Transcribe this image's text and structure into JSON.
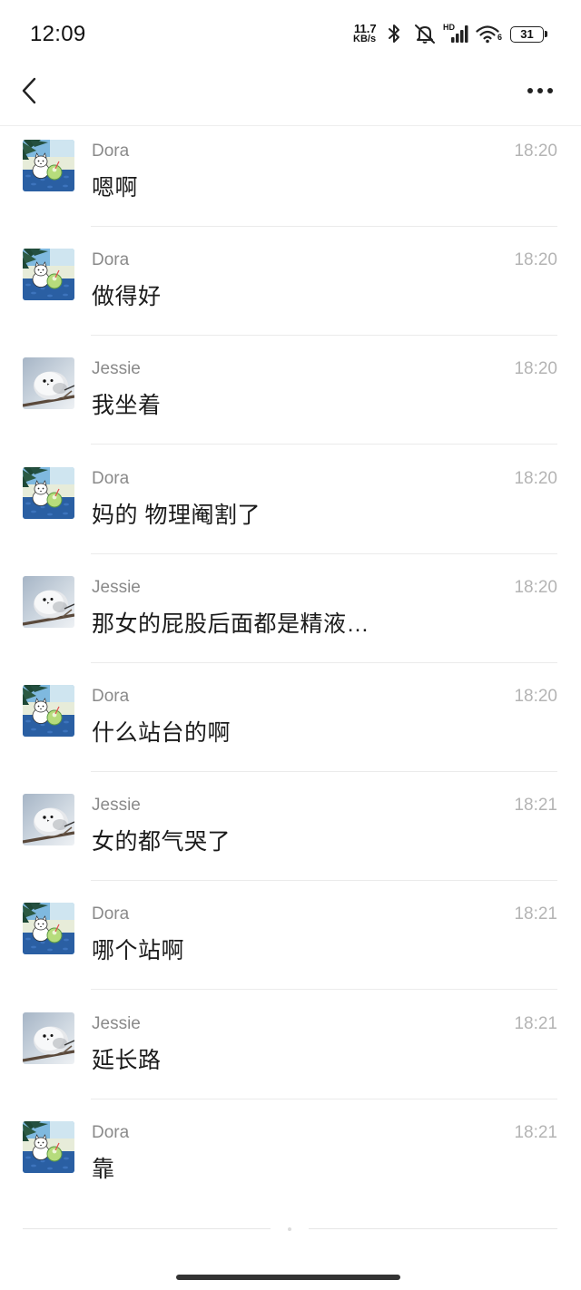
{
  "status_bar": {
    "time": "12:09",
    "net_speed": "11.7",
    "net_speed_unit": "KB/s",
    "signal_label": "HD",
    "wifi_label": "6",
    "battery_level": "31",
    "icons": [
      "bluetooth-icon",
      "notifications-muted-icon",
      "cellular-signal-icon",
      "wifi-icon",
      "battery-icon"
    ]
  },
  "nav": {
    "back_icon": "chevron-left-icon",
    "more_icon": "more-dots-icon"
  },
  "messages": [
    {
      "sender": "Dora",
      "time": "18:20",
      "text": "嗯啊",
      "avatar": "dora-avatar"
    },
    {
      "sender": "Dora",
      "time": "18:20",
      "text": "做得好",
      "avatar": "dora-avatar"
    },
    {
      "sender": "Jessie",
      "time": "18:20",
      "text": "我坐着",
      "avatar": "jessie-avatar"
    },
    {
      "sender": "Dora",
      "time": "18:20",
      "text": "妈的 物理阉割了",
      "avatar": "dora-avatar"
    },
    {
      "sender": "Jessie",
      "time": "18:20",
      "text": "那女的屁股后面都是精液…",
      "avatar": "jessie-avatar"
    },
    {
      "sender": "Dora",
      "time": "18:20",
      "text": "什么站台的啊",
      "avatar": "dora-avatar"
    },
    {
      "sender": "Jessie",
      "time": "18:21",
      "text": "女的都气哭了",
      "avatar": "jessie-avatar"
    },
    {
      "sender": "Dora",
      "time": "18:21",
      "text": "哪个站啊",
      "avatar": "dora-avatar"
    },
    {
      "sender": "Jessie",
      "time": "18:21",
      "text": "延长路",
      "avatar": "jessie-avatar"
    },
    {
      "sender": "Dora",
      "time": "18:21",
      "text": "靠",
      "avatar": "dora-avatar"
    }
  ],
  "colors": {
    "background": "#ffffff",
    "message_text": "#1b1b1b",
    "sender_name": "#8a8a8a",
    "timestamp": "#b4b4b4",
    "divider": "#ebebeb"
  }
}
